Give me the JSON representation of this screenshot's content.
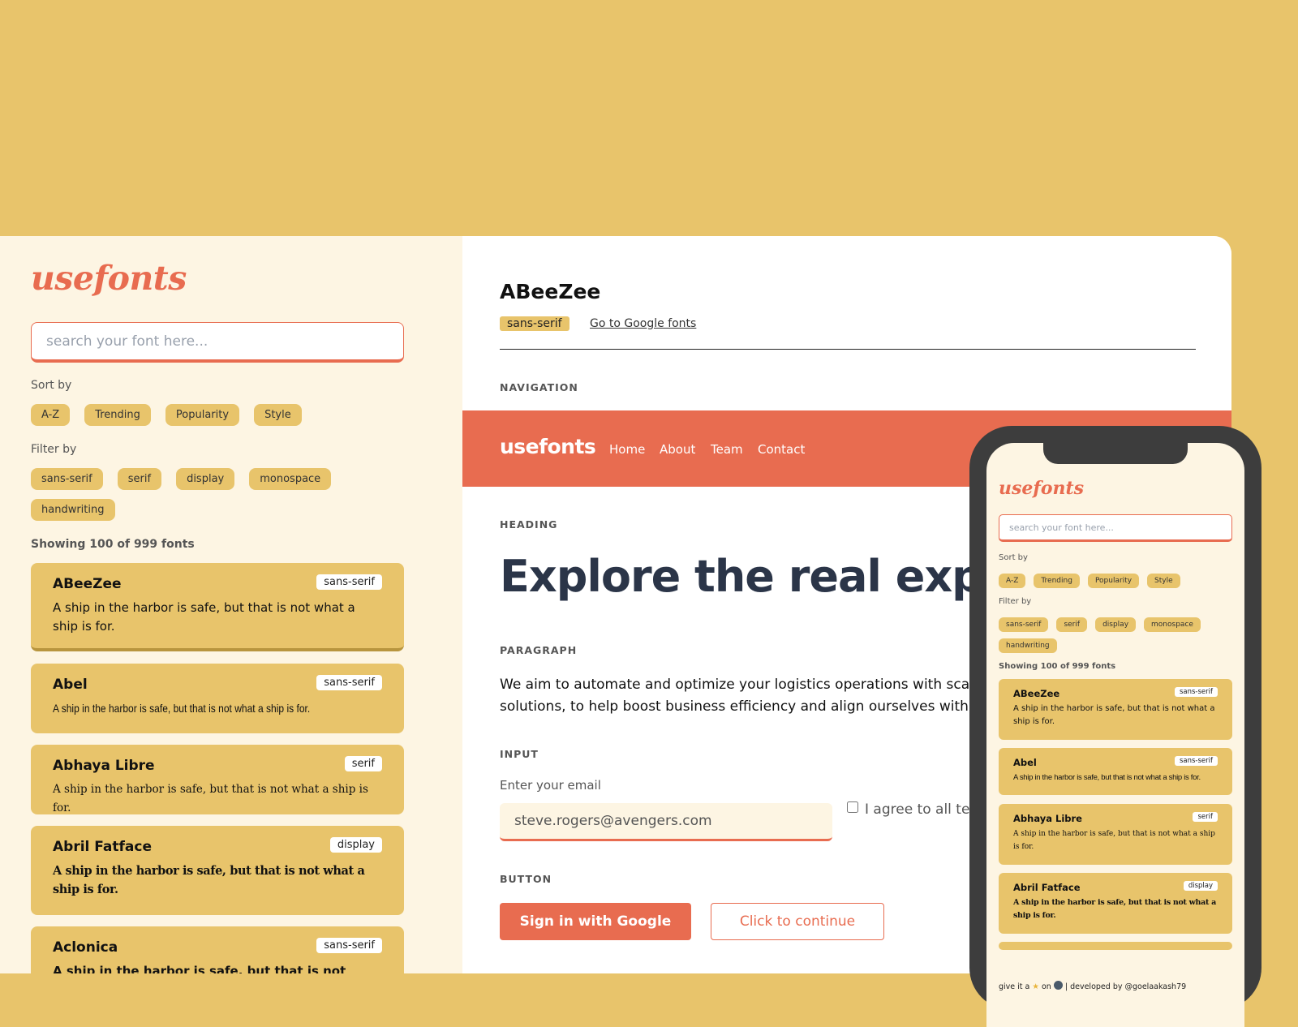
{
  "sidebar": {
    "logo": "usefonts",
    "search_placeholder": "search your font here...",
    "sort_label": "Sort by",
    "sort_options": [
      "A-Z",
      "Trending",
      "Popularity",
      "Style"
    ],
    "filter_label": "Filter by",
    "filter_options": [
      "sans-serif",
      "serif",
      "display",
      "monospace",
      "handwriting"
    ],
    "showing": "Showing 100 of 999 fonts",
    "fonts": [
      {
        "name": "ABeeZee",
        "tag": "sans-serif",
        "sample": "A ship in the harbor is safe, but that is not what a ship is for."
      },
      {
        "name": "Abel",
        "tag": "sans-serif",
        "sample": "A ship in the harbor is safe, but that is not what a ship is for."
      },
      {
        "name": "Abhaya Libre",
        "tag": "serif",
        "sample": "A ship in the harbor is safe, but that is not what a ship is for."
      },
      {
        "name": "Abril Fatface",
        "tag": "display",
        "sample": "A ship in the harbor is safe, but that is not what a ship is for."
      },
      {
        "name": "Aclonica",
        "tag": "sans-serif",
        "sample": "A ship in the harbor is safe, but that is not"
      }
    ]
  },
  "main": {
    "font_name": "ABeeZee",
    "font_category": "sans-serif",
    "google_link": "Go to Google fonts",
    "sections": {
      "navigation": "NAVIGATION",
      "heading": "HEADING",
      "paragraph": "PARAGRAPH",
      "input": "INPUT",
      "button": "BUTTON"
    },
    "navbar": {
      "logo": "usefonts",
      "links": [
        "Home",
        "About",
        "Team",
        "Contact"
      ]
    },
    "heading_text": "Explore the real experi",
    "paragraph_lines": [
      "We aim to automate and optimize your logistics operations with sca",
      "solutions, to help boost business efficiency and align ourselves with"
    ],
    "email_label": "Enter your email",
    "email_value": "steve.rogers@avengers.com",
    "agree_text": "I agree to all te",
    "btn_primary": "Sign in with Google",
    "btn_secondary": "Click to continue"
  },
  "phone": {
    "logo": "usefonts",
    "search_placeholder": "search your font here...",
    "sort_label": "Sort by",
    "sort_options": [
      "A-Z",
      "Trending",
      "Popularity",
      "Style"
    ],
    "filter_label": "Filter by",
    "filter_options": [
      "sans-serif",
      "serif",
      "display",
      "monospace",
      "handwriting"
    ],
    "showing": "Showing 100 of 999 fonts",
    "fonts": [
      {
        "name": "ABeeZee",
        "tag": "sans-serif",
        "sample": "A ship in the harbor is safe, but that is not what a ship is for."
      },
      {
        "name": "Abel",
        "tag": "sans-serif",
        "sample": "A ship in the harbor is safe, but that is not what a ship is for."
      },
      {
        "name": "Abhaya Libre",
        "tag": "serif",
        "sample": "A ship in the harbor is safe, but that is not what a ship is for."
      },
      {
        "name": "Abril Fatface",
        "tag": "display",
        "sample": "A ship in the harbor is safe, but that is not what a ship is for."
      }
    ],
    "footer_prefix": "give it a",
    "footer_on": "on",
    "footer_credit": "| developed by @goelaakash79",
    "star_icon": "star-icon",
    "github_icon": "github-icon"
  },
  "colors": {
    "background": "#e8c46b",
    "accent": "#e86c50",
    "sidebar_bg": "#fdf5e3",
    "heading_text": "#2b3548"
  }
}
